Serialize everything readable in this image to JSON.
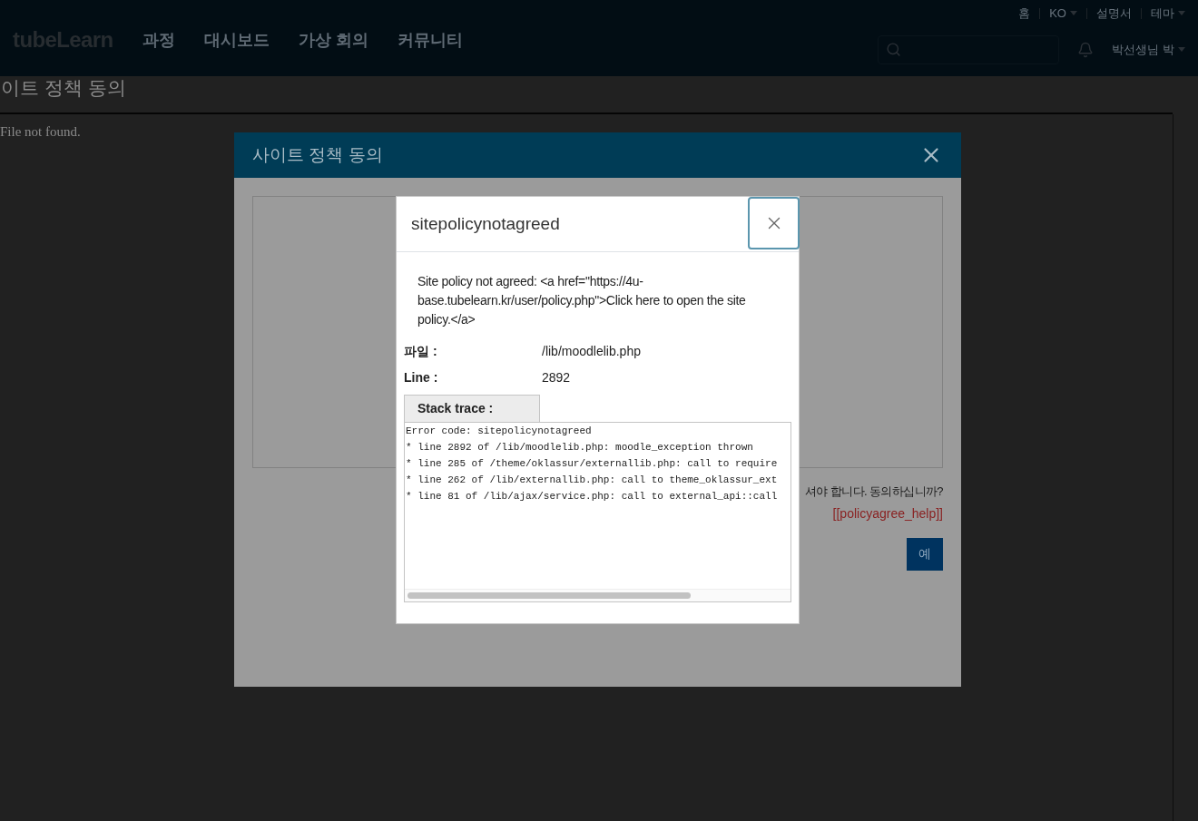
{
  "header": {
    "logo": "tubeLearn",
    "nav": [
      "과정",
      "대시보드",
      "가상 회의",
      "커뮤니티"
    ],
    "top_links": [
      {
        "label": "홈",
        "dropdown": false
      },
      {
        "label": "KO",
        "dropdown": true
      },
      {
        "label": "설명서",
        "dropdown": false
      },
      {
        "label": "테마",
        "dropdown": true
      }
    ],
    "user": "박선생님 박"
  },
  "page": {
    "title": "이트 정책 동의",
    "message": "File not found."
  },
  "policy_modal": {
    "title": "사이트 정책 동의",
    "question": "셔야 합니다. 동의하십니까?",
    "help_link": "[[policyagree_help]]",
    "button": "예"
  },
  "error_dialog": {
    "title": "sitepolicynotagreed",
    "message": "Site policy not agreed: <a href=\"https://4u-base.tubelearn.kr/user/policy.php\">Click here to open the site policy.</a>",
    "details": [
      {
        "label": "파일 :",
        "value": "/lib/moodlelib.php"
      },
      {
        "label": "Line :",
        "value": "2892"
      }
    ],
    "stack_label": "Stack trace :",
    "stack_lines": [
      "Error code: sitepolicynotagreed",
      "* line 2892 of /lib/moodlelib.php: moodle_exception thrown",
      "* line 285 of /theme/oklassur/externallib.php: call to require",
      "* line 262 of /lib/externallib.php: call to theme_oklassur_ext",
      "* line 81 of /lib/ajax/service.php: call to external_api::call"
    ]
  }
}
